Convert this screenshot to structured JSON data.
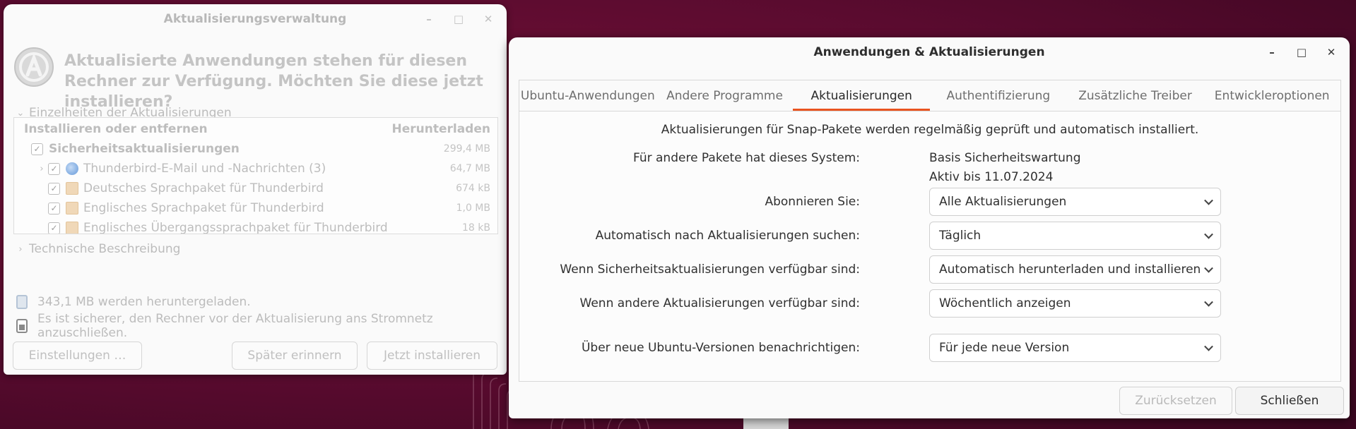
{
  "update_manager": {
    "title": "Aktualisierungsverwaltung",
    "headline": "Aktualisierte Anwendungen stehen für diesen Rechner zur Verfügung. Möchten Sie diese jetzt installieren?",
    "details_expander": "Einzelheiten der Aktualisierungen",
    "columns": {
      "name": "Installieren oder entfernen",
      "size": "Herunterladen"
    },
    "packages": [
      {
        "label": "Sicherheitsaktualisierungen",
        "size": "299,4 MB",
        "checked": true,
        "icon": "none"
      },
      {
        "label": "Thunderbird-E-Mail und -Nachrichten (3)",
        "size": "64,7 MB",
        "checked": true,
        "icon": "thunderbird-icon"
      },
      {
        "label": "Deutsches Sprachpaket für Thunderbird",
        "size": "674 kB",
        "checked": true,
        "icon": "package-icon"
      },
      {
        "label": "Englisches Sprachpaket für Thunderbird",
        "size": "1,0 MB",
        "checked": true,
        "icon": "package-icon"
      },
      {
        "label": "Englisches Übergangssprachpaket für Thunderbird",
        "size": "18 kB",
        "checked": true,
        "icon": "package-icon"
      }
    ],
    "tech_expander": "Technische Beschreibung",
    "download_info": "343,1 MB werden heruntergeladen.",
    "power_info": "Es ist sicherer, den Rechner vor der Aktualisierung ans Stromnetz anzuschließen.",
    "buttons": {
      "settings": "Einstellungen …",
      "remind_later": "Später erinnern",
      "install_now": "Jetzt installieren"
    }
  },
  "software_updates": {
    "title": "Anwendungen & Aktualisierungen",
    "tabs": [
      "Ubuntu-Anwendungen",
      "Andere Programme",
      "Aktualisierungen",
      "Authentifizierung",
      "Zusätzliche Treiber",
      "Entwickleroptionen"
    ],
    "active_tab": "Aktualisierungen",
    "snap_note": "Aktualisierungen für Snap-Pakete werden regelmäßig geprüft und automatisch installiert.",
    "system_label": "Für andere Pakete hat dieses System:",
    "system_value": "Basis Sicherheitswartung",
    "system_active": "Aktiv bis 11.07.2024",
    "subscribe_label": "Abonnieren Sie:",
    "subscribe_value": "Alle Aktualisierungen",
    "auto_check_label": "Automatisch nach Aktualisierungen suchen:",
    "auto_check_value": "Täglich",
    "security_label": "Wenn Sicherheitsaktualisierungen verfügbar sind:",
    "security_value": "Automatisch herunterladen und installieren",
    "other_label": "Wenn andere Aktualisierungen verfügbar sind:",
    "other_value": "Wöchentlich anzeigen",
    "notify_label": "Über neue Ubuntu-Versionen benachrichtigen:",
    "notify_value": "Für jede neue Version",
    "buttons": {
      "revert": "Zurücksetzen",
      "close": "Schließen"
    }
  },
  "colors": {
    "accent": "#e95420",
    "desktop": "#5a0b2f"
  }
}
